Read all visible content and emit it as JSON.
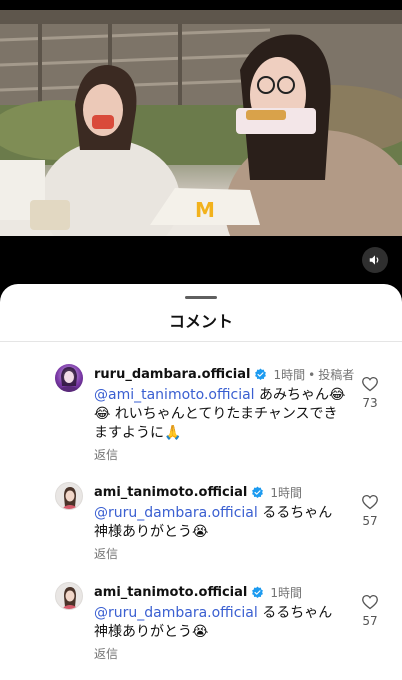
{
  "sheet": {
    "title": "コメント"
  },
  "comments": [
    {
      "username": "ruru_dambara.official",
      "time": "1時間",
      "author_badge": "投稿者",
      "mention": "@ami_tanimoto.official",
      "text": " あみちゃん😂😂 れいちゃんとてりたまチャンスできますように🙏",
      "reply_label": "返信",
      "likes": "73",
      "avatar": "purple-portrait-avatar",
      "verified": true
    },
    {
      "username": "ami_tanimoto.official",
      "time": "1時間",
      "author_badge": "",
      "mention": "@ruru_dambara.official",
      "text": " るるちゃん神様ありがとう😭",
      "reply_label": "返信",
      "likes": "57",
      "avatar": "portrait-avatar",
      "verified": true
    },
    {
      "username": "ami_tanimoto.official",
      "time": "1時間",
      "author_badge": "",
      "mention": "@ruru_dambara.official",
      "text": " るるちゃん神様ありがとう😭",
      "reply_label": "返信",
      "likes": "57",
      "avatar": "portrait-avatar",
      "verified": true
    }
  ],
  "icons": {
    "mute": "speaker-icon",
    "like": "heart-icon",
    "verified": "verified-badge-icon"
  },
  "colors": {
    "mention": "#3a5fd1",
    "verified": "#1d9bf0"
  }
}
